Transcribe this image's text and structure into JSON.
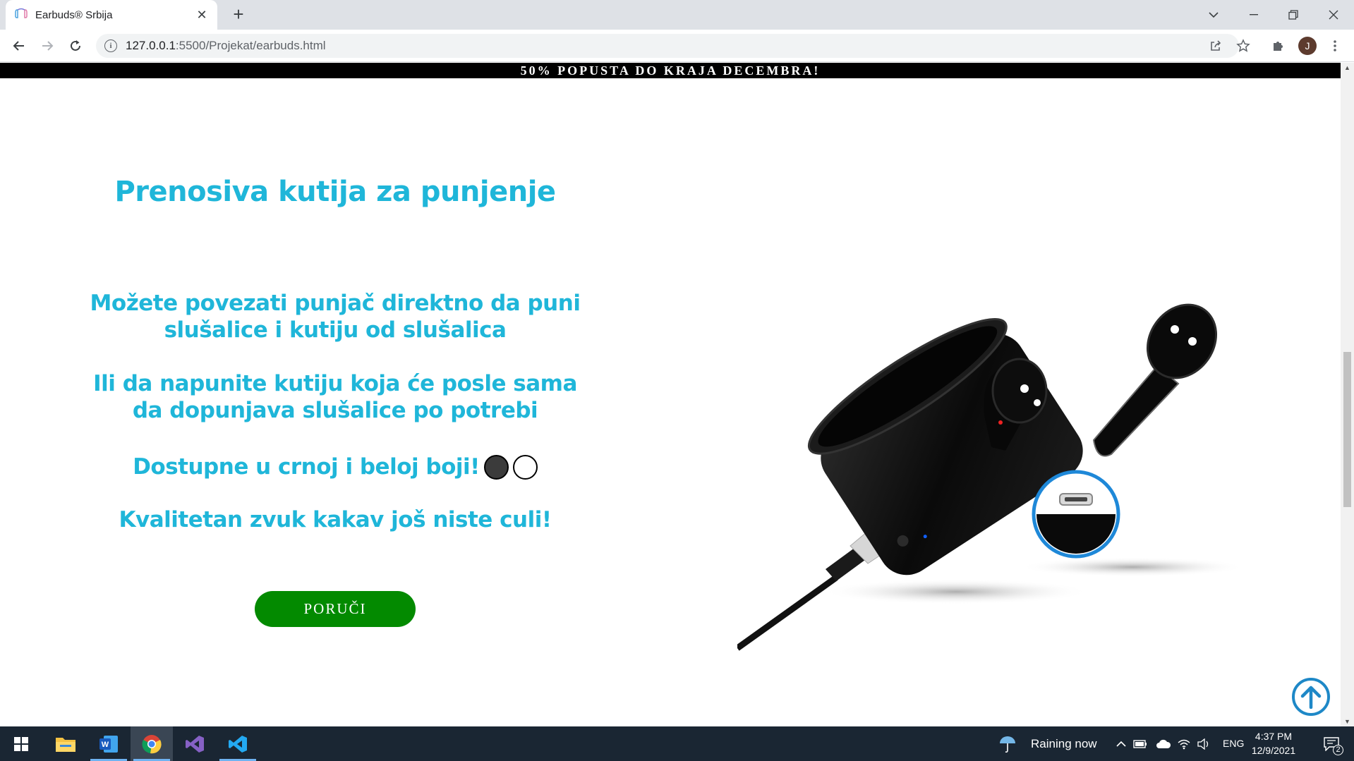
{
  "browser": {
    "tab_title": "Earbuds® Srbija",
    "tab_close": "✕",
    "new_tab": "+",
    "url_host": "127.0.0.1",
    "url_rest": ":5500/Projekat/earbuds.html",
    "avatar_letter": "J"
  },
  "page": {
    "promo_banner": "50% POPUSTA DO KRAJA DECEMBRA!",
    "heading": "Prenosiva kutija za punjenje",
    "paragraph_1": "Možete povezati punjač direktno da puni slušalice i kutiju od slušalica",
    "paragraph_2": "Ili da napunite kutiju koja će posle sama da dopunjava slušalice po potrebi",
    "paragraph_3": "Dostupne u crnoj i beloj boji!",
    "paragraph_4": "Kvalitetan zvuk kakav još niste culi!",
    "order_button": "PORUČI",
    "colors": {
      "accent": "#1fb6d9",
      "button": "#038a00",
      "scroll_top": "#1e88c7"
    }
  },
  "taskbar": {
    "weather": "Raining now",
    "language": "ENG",
    "time": "4:37 PM",
    "date": "12/9/2021",
    "notifications": "2"
  }
}
